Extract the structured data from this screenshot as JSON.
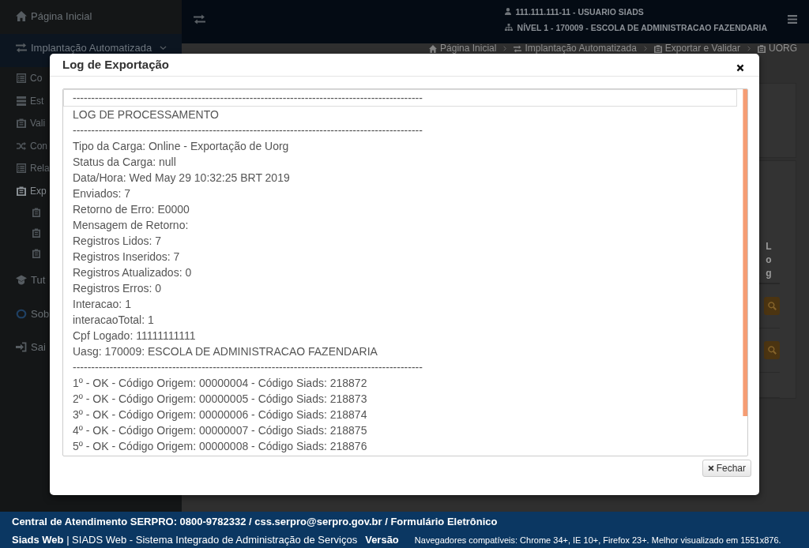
{
  "sidebar": {
    "items": [
      {
        "label": "Página Inicial",
        "selected": false
      },
      {
        "label": "Implantação Automatizada",
        "selected": true,
        "expanded": true,
        "children": [
          {
            "label": "Co"
          },
          {
            "label": "Est"
          },
          {
            "label": "Vali"
          },
          {
            "label": "Con"
          },
          {
            "label": "Rela"
          },
          {
            "label": "Exp",
            "expanded": true,
            "children": [
              {
                "kind": "leaf"
              },
              {
                "kind": "leaf"
              },
              {
                "kind": "leaf"
              }
            ]
          }
        ]
      },
      {
        "label": "Tut",
        "selected": false
      },
      {
        "label": "Sob",
        "selected": false
      },
      {
        "label": "Sai",
        "selected": false
      }
    ]
  },
  "topbar": {
    "user": "111.111.111-11 - USUARIO SIADS",
    "unit": "NÍVEL 1 - 170009 - ESCOLA DE ADMINISTRACAO FAZENDARIA"
  },
  "breadcrumb": [
    "Página Inicial",
    "Implantação Automatizada",
    "Exportar e Validar",
    "UORG"
  ],
  "table": {
    "columns": [
      {
        "label": "Log"
      }
    ],
    "rows": [
      {
        "kind": "search"
      },
      {
        "kind": "search"
      },
      {
        "kind": "empty"
      }
    ]
  },
  "modal": {
    "title": "Log de Exportação",
    "lines": [
      {
        "text": "-----------------------------------------------------------------------------------------------",
        "outlined": true
      },
      {
        "text": "LOG DE PROCESSAMENTO",
        "outlined": false
      },
      {
        "text": "-----------------------------------------------------------------------------------------------",
        "outlined": false
      },
      {
        "text": "Tipo da Carga: Online - Exportação de Uorg",
        "outlined": false
      },
      {
        "text": "Status da Carga: null",
        "outlined": false
      },
      {
        "text": "Data/Hora: Wed May 29 10:32:25 BRT 2019",
        "outlined": false
      },
      {
        "text": "Enviados: 7",
        "outlined": false
      },
      {
        "text": "Retorno de Erro: E0000",
        "outlined": false
      },
      {
        "text": "Mensagem de Retorno:",
        "outlined": false
      },
      {
        "text": "Registros Lidos: 7",
        "outlined": false
      },
      {
        "text": "Registros Inseridos: 7",
        "outlined": false
      },
      {
        "text": "Registros Atualizados: 0",
        "outlined": false
      },
      {
        "text": "Registros Erros: 0",
        "outlined": false
      },
      {
        "text": "Interacao: 1",
        "outlined": false
      },
      {
        "text": "interacaoTotal: 1",
        "outlined": false
      },
      {
        "text": "Cpf Logado: 11111111111",
        "outlined": false
      },
      {
        "text": "Uasg: 170009: ESCOLA DE ADMINISTRACAO FAZENDARIA",
        "outlined": false
      },
      {
        "text": "-----------------------------------------------------------------------------------------------",
        "outlined": false
      },
      {
        "text": "1º - OK - Código Origem: 00000004 - Código Siads: 218872",
        "outlined": false
      },
      {
        "text": "2º - OK - Código Origem: 00000005 - Código Siads: 218873",
        "outlined": false
      },
      {
        "text": "3º - OK - Código Origem: 00000006 - Código Siads: 218874",
        "outlined": false
      },
      {
        "text": "4º - OK - Código Origem: 00000007 - Código Siads: 218875",
        "outlined": false
      },
      {
        "text": "5º - OK - Código Origem: 00000008 - Código Siads: 218876",
        "outlined": false
      }
    ],
    "close_button": "Fechar"
  },
  "footer": {
    "contact": "Central de Atendimento SERPRO: 0800-9782332 / css.serpro@serpro.gov.br / Formulário Eletrônico",
    "app": "**Siads Web** | SIADS Web - Sistema Integrado de Administração de Serviços",
    "version_label": "Versão",
    "browsers": "Navegadores compatíveis: Chrome 34+, IE 10+, Firefox 23+. Melhor visualizado em 1551x876."
  }
}
